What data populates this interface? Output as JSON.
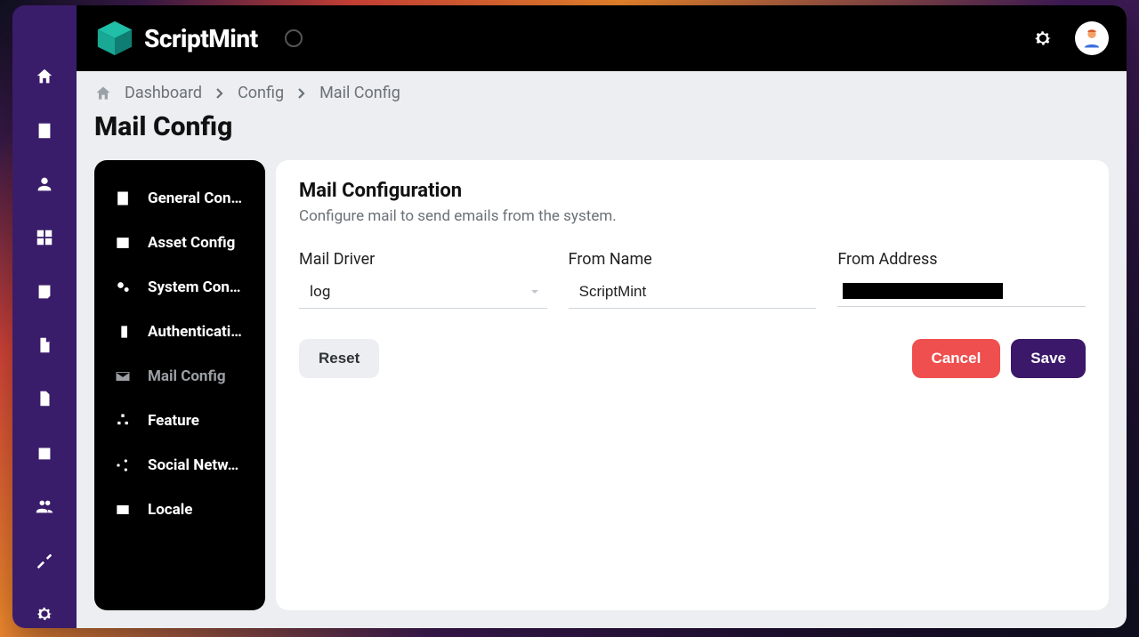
{
  "brand": {
    "name": "ScriptMint"
  },
  "breadcrumb": {
    "items": [
      "Dashboard",
      "Config",
      "Mail Config"
    ]
  },
  "page": {
    "title": "Mail Config"
  },
  "config_nav": {
    "items": [
      {
        "label": "General Con…"
      },
      {
        "label": "Asset Config"
      },
      {
        "label": "System Con…"
      },
      {
        "label": "Authenticati…"
      },
      {
        "label": "Mail Config"
      },
      {
        "label": "Feature"
      },
      {
        "label": "Social Netw…"
      },
      {
        "label": "Locale"
      }
    ],
    "active_index": 4
  },
  "card": {
    "title": "Mail Configuration",
    "subtitle": "Configure mail to send emails from the system."
  },
  "form": {
    "mail_driver": {
      "label": "Mail Driver",
      "value": "log"
    },
    "from_name": {
      "label": "From Name",
      "value": "ScriptMint"
    },
    "from_address": {
      "label": "From Address"
    }
  },
  "buttons": {
    "reset": "Reset",
    "cancel": "Cancel",
    "save": "Save"
  }
}
